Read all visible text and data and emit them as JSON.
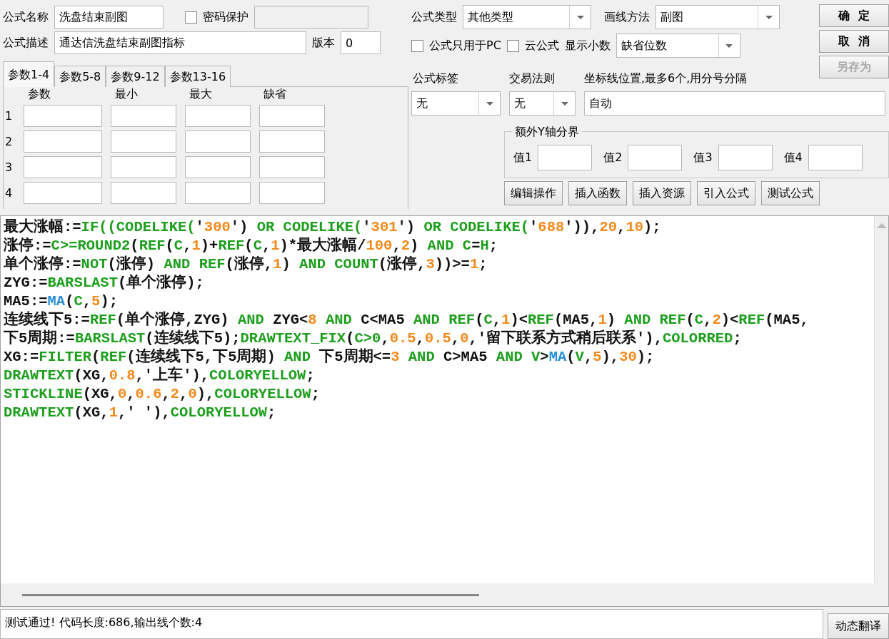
{
  "formula_name": {
    "label": "公式名称",
    "value": "洗盘结束副图"
  },
  "password": {
    "label": "密码保护",
    "checked": false
  },
  "description": {
    "label": "公式描述",
    "value": "通达信洗盘结束副图指标"
  },
  "version": {
    "label": "版本",
    "value": "0"
  },
  "param_tabs": [
    {
      "label": "参数1-4",
      "selected": true
    },
    {
      "label": "参数5-8",
      "selected": false
    },
    {
      "label": "参数9-12",
      "selected": false
    },
    {
      "label": "参数13-16",
      "selected": false
    }
  ],
  "param_columns": [
    "参数",
    "最小",
    "最大",
    "缺省"
  ],
  "param_rows": [
    "1",
    "2",
    "3",
    "4"
  ],
  "formula_type": {
    "label": "公式类型",
    "value": "其他类型"
  },
  "draw_method": {
    "label": "画线方法",
    "value": "副图"
  },
  "pc_only": {
    "label": "公式只用于PC",
    "checked": false
  },
  "cloud": {
    "label": "云公式",
    "checked": false
  },
  "decimals": {
    "label": "显示小数",
    "value": "缺省位数"
  },
  "buttons": [
    {
      "label": "确  定",
      "disabled": false
    },
    {
      "label": "取  消",
      "disabled": false
    },
    {
      "label": "另存为",
      "disabled": true
    }
  ],
  "formula_tag": {
    "label": "公式标签",
    "value": "无"
  },
  "trade_rule": {
    "label": "交易法则",
    "value": "无"
  },
  "axis_lines": {
    "label": "坐标线位置,最多6个,用分号分隔",
    "value": "自动"
  },
  "extra_y": {
    "title": "额外Y轴分界",
    "fields": [
      "值1",
      "值2",
      "值3",
      "值4"
    ]
  },
  "tool_buttons": [
    "编辑操作",
    "插入函数",
    "插入资源",
    "引入公式",
    "测试公式"
  ],
  "code_lines": [
    [
      {
        "kind": "plain",
        "text": "最大涨幅:="
      },
      {
        "kind": "func",
        "text": "IF((CODELIKE("
      },
      {
        "kind": "plain",
        "text": "'"
      },
      {
        "kind": "num",
        "text": "300"
      },
      {
        "kind": "plain",
        "text": "') "
      },
      {
        "kind": "func",
        "text": "OR CODELIKE("
      },
      {
        "kind": "plain",
        "text": "'"
      },
      {
        "kind": "num",
        "text": "301"
      },
      {
        "kind": "plain",
        "text": "') "
      },
      {
        "kind": "func",
        "text": "OR CODELIKE("
      },
      {
        "kind": "plain",
        "text": "'"
      },
      {
        "kind": "num",
        "text": "688"
      },
      {
        "kind": "plain",
        "text": "')),"
      },
      {
        "kind": "num",
        "text": "20"
      },
      {
        "kind": "plain",
        "text": ","
      },
      {
        "kind": "num",
        "text": "10"
      },
      {
        "kind": "plain",
        "text": ");"
      }
    ],
    [
      {
        "kind": "plain",
        "text": "涨停:="
      },
      {
        "kind": "func",
        "text": "C>=ROUND2"
      },
      {
        "kind": "plain",
        "text": "("
      },
      {
        "kind": "func",
        "text": "REF"
      },
      {
        "kind": "plain",
        "text": "("
      },
      {
        "kind": "func",
        "text": "C"
      },
      {
        "kind": "plain",
        "text": ","
      },
      {
        "kind": "num",
        "text": "1"
      },
      {
        "kind": "plain",
        "text": ")+"
      },
      {
        "kind": "func",
        "text": "REF"
      },
      {
        "kind": "plain",
        "text": "("
      },
      {
        "kind": "func",
        "text": "C"
      },
      {
        "kind": "plain",
        "text": ","
      },
      {
        "kind": "num",
        "text": "1"
      },
      {
        "kind": "plain",
        "text": ")*最大涨幅/"
      },
      {
        "kind": "num",
        "text": "100"
      },
      {
        "kind": "plain",
        "text": ","
      },
      {
        "kind": "num",
        "text": "2"
      },
      {
        "kind": "plain",
        "text": ") "
      },
      {
        "kind": "func",
        "text": "AND C"
      },
      {
        "kind": "plain",
        "text": "="
      },
      {
        "kind": "func",
        "text": "H"
      },
      {
        "kind": "plain",
        "text": ";"
      }
    ],
    [
      {
        "kind": "plain",
        "text": "单个涨停:="
      },
      {
        "kind": "func",
        "text": "NOT"
      },
      {
        "kind": "plain",
        "text": "(涨停) "
      },
      {
        "kind": "func",
        "text": "AND REF"
      },
      {
        "kind": "plain",
        "text": "(涨停,"
      },
      {
        "kind": "num",
        "text": "1"
      },
      {
        "kind": "plain",
        "text": ") "
      },
      {
        "kind": "func",
        "text": "AND COUNT"
      },
      {
        "kind": "plain",
        "text": "(涨停,"
      },
      {
        "kind": "num",
        "text": "3"
      },
      {
        "kind": "plain",
        "text": "))>="
      },
      {
        "kind": "num",
        "text": "1"
      },
      {
        "kind": "plain",
        "text": ";"
      }
    ],
    [
      {
        "kind": "plain",
        "text": "ZYG:="
      },
      {
        "kind": "func",
        "text": "BARSLAST"
      },
      {
        "kind": "plain",
        "text": "(单个涨停);"
      }
    ],
    [
      {
        "kind": "plain",
        "text": "MA5:="
      },
      {
        "kind": "builtin",
        "text": "MA"
      },
      {
        "kind": "plain",
        "text": "("
      },
      {
        "kind": "func",
        "text": "C"
      },
      {
        "kind": "plain",
        "text": ","
      },
      {
        "kind": "num",
        "text": "5"
      },
      {
        "kind": "plain",
        "text": ");"
      }
    ],
    [
      {
        "kind": "plain",
        "text": "连续线下5:="
      },
      {
        "kind": "func",
        "text": "REF"
      },
      {
        "kind": "plain",
        "text": "(单个涨停,ZYG) "
      },
      {
        "kind": "func",
        "text": "AND"
      },
      {
        "kind": "plain",
        "text": " ZYG<"
      },
      {
        "kind": "num",
        "text": "8"
      },
      {
        "kind": "func",
        "text": " AND"
      },
      {
        "kind": "plain",
        "text": " C<MA5 "
      },
      {
        "kind": "func",
        "text": "AND REF"
      },
      {
        "kind": "plain",
        "text": "("
      },
      {
        "kind": "func",
        "text": "C"
      },
      {
        "kind": "plain",
        "text": ","
      },
      {
        "kind": "num",
        "text": "1"
      },
      {
        "kind": "plain",
        "text": ")<"
      },
      {
        "kind": "func",
        "text": "REF"
      },
      {
        "kind": "plain",
        "text": "(MA5,"
      },
      {
        "kind": "num",
        "text": "1"
      },
      {
        "kind": "plain",
        "text": ") "
      },
      {
        "kind": "func",
        "text": "AND REF"
      },
      {
        "kind": "plain",
        "text": "("
      },
      {
        "kind": "func",
        "text": "C"
      },
      {
        "kind": "plain",
        "text": ","
      },
      {
        "kind": "num",
        "text": "2"
      },
      {
        "kind": "plain",
        "text": ")<"
      },
      {
        "kind": "func",
        "text": "REF"
      },
      {
        "kind": "plain",
        "text": "(MA5,"
      }
    ],
    [
      {
        "kind": "plain",
        "text": "下5周期:="
      },
      {
        "kind": "func",
        "text": "BARSLAST"
      },
      {
        "kind": "plain",
        "text": "(连续线下5);"
      },
      {
        "kind": "func",
        "text": "DRAWTEXT_FIX"
      },
      {
        "kind": "plain",
        "text": "("
      },
      {
        "kind": "func",
        "text": "C>0"
      },
      {
        "kind": "plain",
        "text": ","
      },
      {
        "kind": "num",
        "text": "0.5"
      },
      {
        "kind": "plain",
        "text": ","
      },
      {
        "kind": "num",
        "text": "0.5"
      },
      {
        "kind": "plain",
        "text": ","
      },
      {
        "kind": "num",
        "text": "0"
      },
      {
        "kind": "plain",
        "text": ",'留下联系方式稍后联系'),"
      },
      {
        "kind": "func",
        "text": "COLORRED"
      },
      {
        "kind": "plain",
        "text": ";"
      }
    ],
    [
      {
        "kind": "plain",
        "text": "XG:="
      },
      {
        "kind": "func",
        "text": "FILTER"
      },
      {
        "kind": "plain",
        "text": "("
      },
      {
        "kind": "func",
        "text": "REF"
      },
      {
        "kind": "plain",
        "text": "(连续线下5,下5周期) "
      },
      {
        "kind": "func",
        "text": "AND"
      },
      {
        "kind": "plain",
        "text": " 下5周期<="
      },
      {
        "kind": "num",
        "text": "3"
      },
      {
        "kind": "func",
        "text": " AND"
      },
      {
        "kind": "plain",
        "text": " C>MA5 "
      },
      {
        "kind": "func",
        "text": "AND V"
      },
      {
        "kind": "plain",
        "text": ">"
      },
      {
        "kind": "builtin",
        "text": "MA"
      },
      {
        "kind": "plain",
        "text": "("
      },
      {
        "kind": "func",
        "text": "V"
      },
      {
        "kind": "plain",
        "text": ","
      },
      {
        "kind": "num",
        "text": "5"
      },
      {
        "kind": "plain",
        "text": "),"
      },
      {
        "kind": "num",
        "text": "30"
      },
      {
        "kind": "plain",
        "text": ");"
      }
    ],
    [
      {
        "kind": "func",
        "text": "DRAWTEXT"
      },
      {
        "kind": "plain",
        "text": "(XG,"
      },
      {
        "kind": "num",
        "text": "0.8"
      },
      {
        "kind": "plain",
        "text": ",'上车'),"
      },
      {
        "kind": "func",
        "text": "COLORYELLOW"
      },
      {
        "kind": "plain",
        "text": ";"
      }
    ],
    [
      {
        "kind": "func",
        "text": "STICKLINE"
      },
      {
        "kind": "plain",
        "text": "(XG,"
      },
      {
        "kind": "num",
        "text": "0"
      },
      {
        "kind": "plain",
        "text": ","
      },
      {
        "kind": "num",
        "text": "0.6"
      },
      {
        "kind": "plain",
        "text": ","
      },
      {
        "kind": "num",
        "text": "2"
      },
      {
        "kind": "plain",
        "text": ","
      },
      {
        "kind": "num",
        "text": "0"
      },
      {
        "kind": "plain",
        "text": "),"
      },
      {
        "kind": "func",
        "text": "COLORYELLOW"
      },
      {
        "kind": "plain",
        "text": ";"
      }
    ],
    [
      {
        "kind": "func",
        "text": "DRAWTEXT"
      },
      {
        "kind": "plain",
        "text": "(XG,"
      },
      {
        "kind": "num",
        "text": "1"
      },
      {
        "kind": "plain",
        "text": ",' '),"
      },
      {
        "kind": "func",
        "text": "COLORYELLOW"
      },
      {
        "kind": "plain",
        "text": ";"
      }
    ]
  ],
  "status": "测试通过! 代码长度:686,输出线个数:4",
  "translate_button": "动态翻译"
}
